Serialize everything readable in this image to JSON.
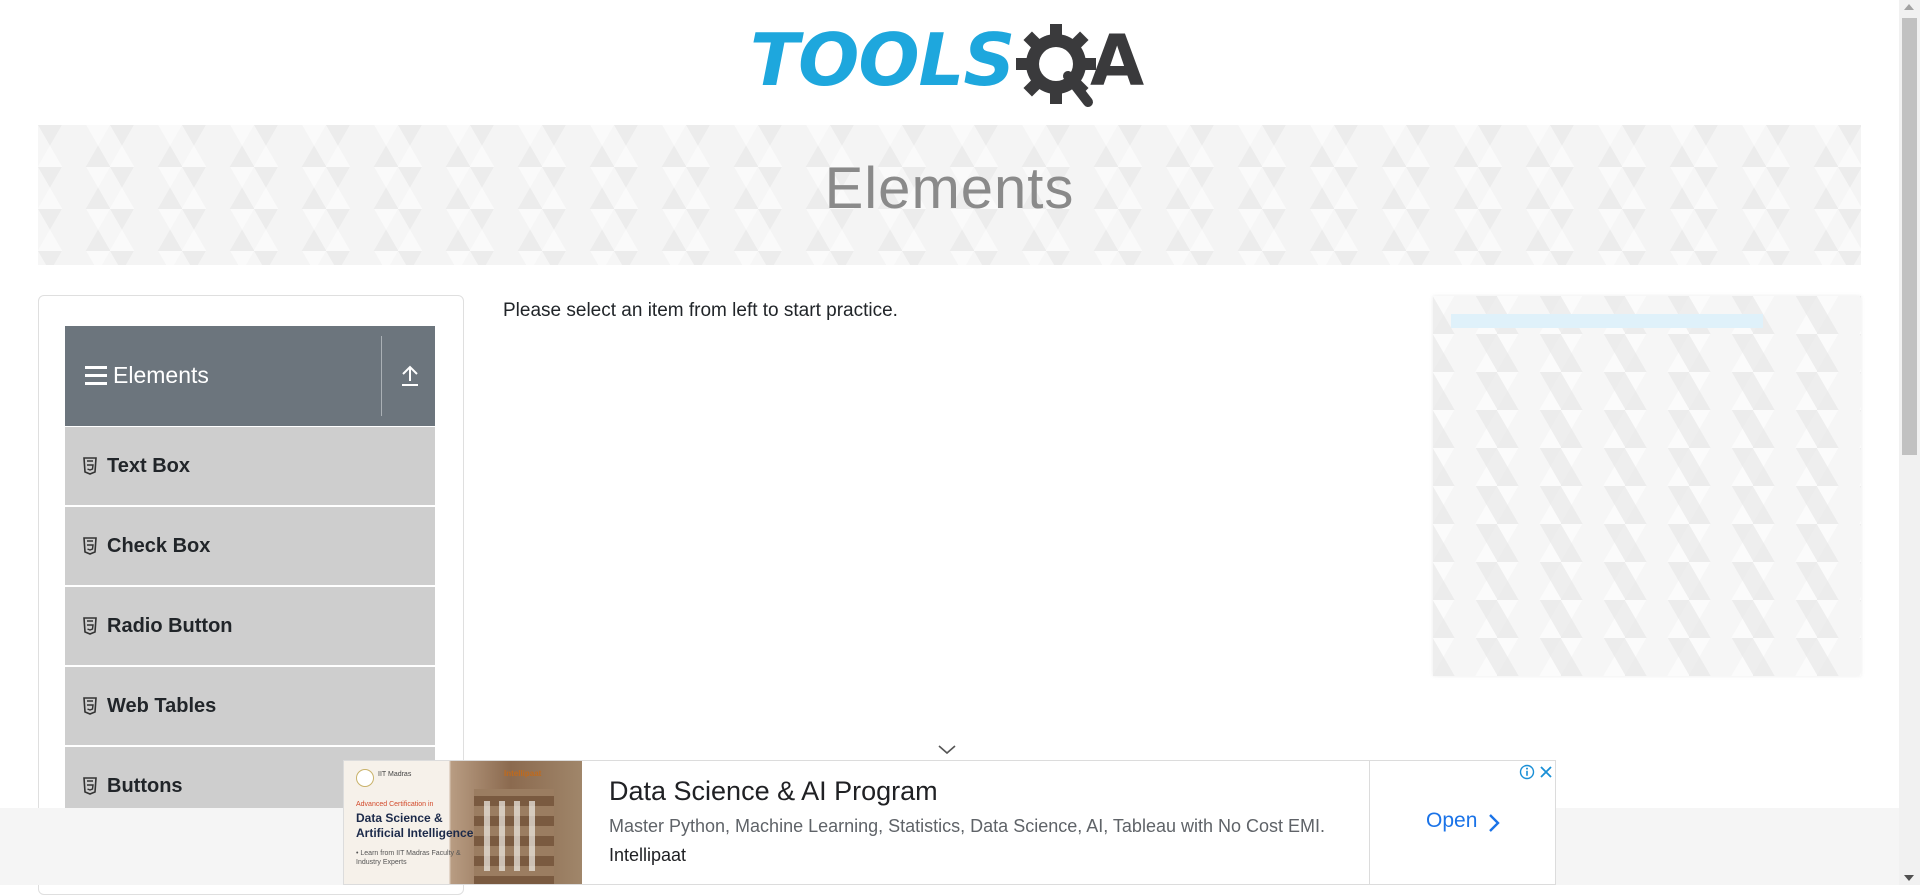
{
  "header": {
    "logo_text": "TOOLS",
    "logo_suffix": "A",
    "brand_colors": {
      "tools": "#1ea7dd",
      "qa": "#3a3a3c"
    }
  },
  "banner": {
    "title": "Elements"
  },
  "sidebar": {
    "group": {
      "title": "Elements",
      "icon": "hamburger-icon",
      "toggle_icon": "upload-arrow-icon"
    },
    "items": [
      {
        "label": "Text Box",
        "icon": "html5-icon"
      },
      {
        "label": "Check Box",
        "icon": "html5-icon"
      },
      {
        "label": "Radio Button",
        "icon": "html5-icon"
      },
      {
        "label": "Web Tables",
        "icon": "html5-icon"
      },
      {
        "label": "Buttons",
        "icon": "html5-icon"
      }
    ],
    "colors": {
      "header_bg": "#6c757d",
      "item_bg": "#cecece"
    }
  },
  "main": {
    "instruction": "Please select an item from left to start practice."
  },
  "bottom_ad": {
    "image": {
      "org": "IIT Madras",
      "partner": "Intellipaat",
      "tagline": "Advanced Certification in",
      "headline": "Data Science & Artificial Intelligence",
      "footnote": "• Learn from IIT Madras Faculty & Industry Experts"
    },
    "title": "Data Science & AI Program",
    "description": "Master Python, Machine Learning, Statistics, Data Science, AI, Tableau with No Cost EMI.",
    "source": "Intellipaat",
    "cta": "Open",
    "accent": "#1a73e8"
  }
}
